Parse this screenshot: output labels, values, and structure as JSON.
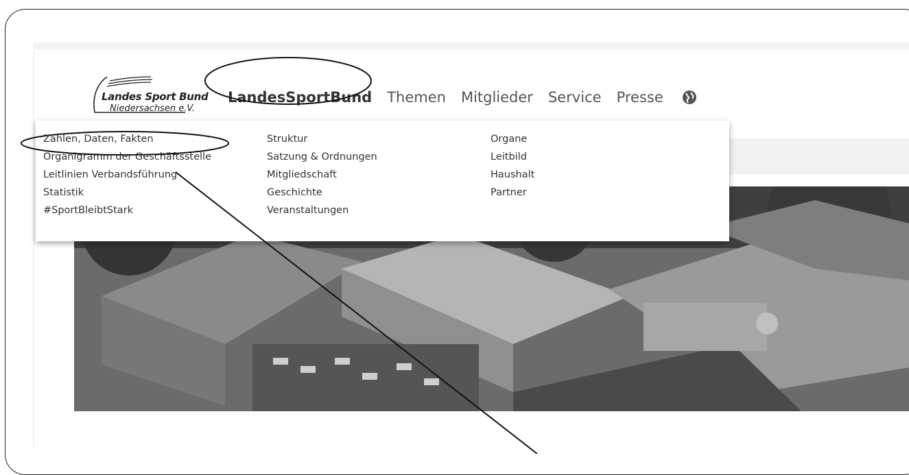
{
  "logo": {
    "line1": "Landes Sport Bund",
    "line2": "Niedersachsen e.V."
  },
  "nav": {
    "items": [
      {
        "label": "LandesSportBund"
      },
      {
        "label": "Themen"
      },
      {
        "label": "Mitglieder"
      },
      {
        "label": "Service"
      },
      {
        "label": "Presse"
      }
    ],
    "language_icon": "globe-icon"
  },
  "dropdown": {
    "columns": [
      {
        "items": [
          "Zahlen, Daten, Fakten",
          "Organigramm der Geschäftsstelle",
          "Leitlinien Verbandsführung",
          "Statistik",
          "#SportBleibtStark"
        ]
      },
      {
        "items": [
          "Struktur",
          "Satzung & Ordnungen",
          "Mitgliedschaft",
          "Geschichte",
          "Veranstaltungen"
        ]
      },
      {
        "items": [
          "Organe",
          "Leitbild",
          "Haushalt",
          "Partner"
        ]
      }
    ]
  },
  "colors": {
    "text": "#333333",
    "nav_text": "#555555",
    "annotation": "#111111"
  }
}
